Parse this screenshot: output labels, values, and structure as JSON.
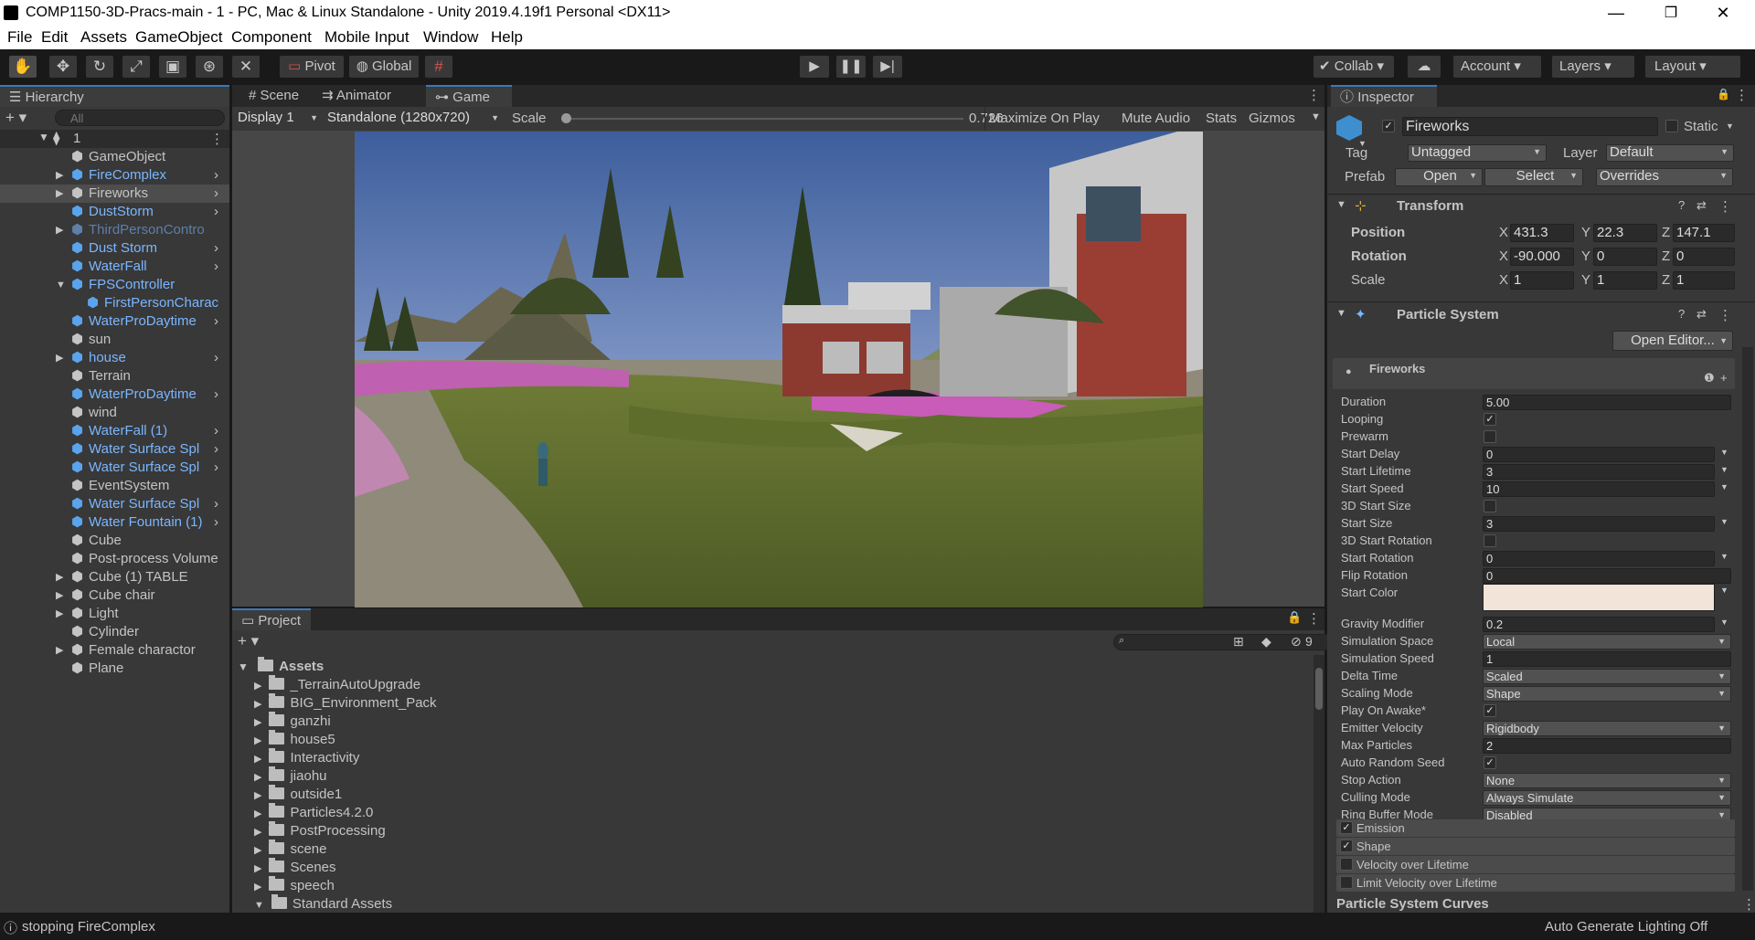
{
  "window": {
    "title": "COMP1150-3D-Pracs-main - 1 - PC, Mac & Linux Standalone - Unity 2019.4.19f1 Personal <DX11>",
    "minimize": "—",
    "restore": "❐",
    "close": "✕"
  },
  "menu": [
    "File",
    "Edit",
    "Assets",
    "GameObject",
    "Component",
    "Mobile Input",
    "Window",
    "Help"
  ],
  "toolbar": {
    "pivot": "Pivot",
    "global": "Global",
    "collab": "Collab",
    "account": "Account",
    "layers": "Layers",
    "layout": "Layout"
  },
  "hierarchy": {
    "tab": "Hierarchy",
    "search_placeholder": "All",
    "scene": "1",
    "items": [
      {
        "label": "GameObject",
        "color": "normal",
        "arrow": false,
        "child": false
      },
      {
        "label": "FireComplex",
        "color": "blue",
        "arrow": true,
        "child": false
      },
      {
        "label": "Fireworks",
        "color": "normal",
        "arrow": true,
        "child": false,
        "selected": true
      },
      {
        "label": "DustStorm",
        "color": "blue",
        "arrow": false,
        "child": false
      },
      {
        "label": "ThirdPersonContro",
        "color": "dim",
        "arrow": true,
        "child": false
      },
      {
        "label": "Dust Storm",
        "color": "blue",
        "arrow": false,
        "child": false
      },
      {
        "label": "WaterFall",
        "color": "blue",
        "arrow": false,
        "child": false
      },
      {
        "label": "FPSController",
        "color": "blue",
        "arrow": true,
        "child": false,
        "expanded": true
      },
      {
        "label": "FirstPersonCharac",
        "color": "blue",
        "arrow": false,
        "child": true
      },
      {
        "label": "WaterProDaytime",
        "color": "blue",
        "arrow": false,
        "child": false
      },
      {
        "label": "sun",
        "color": "normal",
        "arrow": false,
        "child": false
      },
      {
        "label": "house",
        "color": "blue",
        "arrow": true,
        "child": false
      },
      {
        "label": "Terrain",
        "color": "normal",
        "arrow": false,
        "child": false
      },
      {
        "label": "WaterProDaytime",
        "color": "blue",
        "arrow": false,
        "child": false
      },
      {
        "label": "wind",
        "color": "normal",
        "arrow": false,
        "child": false
      },
      {
        "label": "WaterFall (1)",
        "color": "blue",
        "arrow": false,
        "child": false
      },
      {
        "label": "Water Surface Spl",
        "color": "blue",
        "arrow": false,
        "child": false
      },
      {
        "label": "Water Surface Spl",
        "color": "blue",
        "arrow": false,
        "child": false
      },
      {
        "label": "EventSystem",
        "color": "normal",
        "arrow": false,
        "child": false
      },
      {
        "label": "Water Surface Spl",
        "color": "blue",
        "arrow": false,
        "child": false
      },
      {
        "label": "Water Fountain (1)",
        "color": "blue",
        "arrow": false,
        "child": false
      },
      {
        "label": "Cube",
        "color": "normal",
        "arrow": false,
        "child": false
      },
      {
        "label": "Post-process Volume",
        "color": "normal",
        "arrow": false,
        "child": false
      },
      {
        "label": "Cube (1) TABLE",
        "color": "normal",
        "arrow": true,
        "child": false
      },
      {
        "label": "Cube chair",
        "color": "normal",
        "arrow": true,
        "child": false
      },
      {
        "label": "Light",
        "color": "normal",
        "arrow": true,
        "child": false
      },
      {
        "label": "Cylinder",
        "color": "normal",
        "arrow": false,
        "child": false
      },
      {
        "label": "Female charactor",
        "color": "normal",
        "arrow": true,
        "child": false
      },
      {
        "label": "Plane",
        "color": "normal",
        "arrow": false,
        "child": false
      }
    ],
    "prefab_arrows": [
      1,
      2,
      3,
      5,
      6,
      9,
      11,
      13,
      15,
      16,
      17,
      19,
      20
    ]
  },
  "center_tabs": [
    "Scene",
    "Animator",
    "Game"
  ],
  "game": {
    "display": "Display 1",
    "resolution": "Standalone (1280x720)",
    "scale_label": "Scale",
    "scale_value": "0.726",
    "scale_fraction": 0.0,
    "maximize": "Maximize On Play",
    "mute": "Mute Audio",
    "stats": "Stats",
    "gizmos": "Gizmos"
  },
  "project": {
    "tab": "Project",
    "hidden_count": "9",
    "root": "Assets",
    "folders": [
      "_TerrainAutoUpgrade",
      "BIG_Environment_Pack",
      "ganzhi",
      "house5",
      "Interactivity",
      "jiaohu",
      "outside1",
      "Particles4.2.0",
      "PostProcessing",
      "scene",
      "Scenes",
      "speech",
      "Standard Assets"
    ]
  },
  "inspector": {
    "tab": "Inspector",
    "object_name": "Fireworks",
    "static_label": "Static",
    "tag_label": "Tag",
    "tag_value": "Untagged",
    "layer_label": "Layer",
    "layer_value": "Default",
    "prefab_label": "Prefab",
    "open": "Open",
    "select": "Select",
    "overrides": "Overrides",
    "transform": {
      "title": "Transform",
      "position_label": "Position",
      "rotation_label": "Rotation",
      "scale_label": "Scale",
      "position": {
        "x": "431.3",
        "y": "22.3",
        "z": "147.1"
      },
      "rotation": {
        "x": "-90.000",
        "y": "0",
        "z": "0"
      },
      "scale": {
        "x": "1",
        "y": "1",
        "z": "1"
      }
    },
    "particle": {
      "title": "Particle System",
      "open_editor": "Open Editor...",
      "module_name": "Fireworks",
      "rows": [
        {
          "label": "Duration",
          "kind": "text",
          "value": "5.00"
        },
        {
          "label": "Looping",
          "kind": "check",
          "value": "✓"
        },
        {
          "label": "Prewarm",
          "kind": "check",
          "value": ""
        },
        {
          "label": "Start Delay",
          "kind": "textdrop",
          "value": "0"
        },
        {
          "label": "Start Lifetime",
          "kind": "textdrop",
          "value": "3"
        },
        {
          "label": "Start Speed",
          "kind": "textdrop",
          "value": "10"
        },
        {
          "label": "3D Start Size",
          "kind": "check",
          "value": ""
        },
        {
          "label": "Start Size",
          "kind": "textdrop",
          "value": "3"
        },
        {
          "label": "3D Start Rotation",
          "kind": "check",
          "value": ""
        },
        {
          "label": "Start Rotation",
          "kind": "textdrop",
          "value": "0"
        },
        {
          "label": "Flip Rotation",
          "kind": "text",
          "value": "0"
        },
        {
          "label": "Start Color",
          "kind": "color",
          "value": ""
        },
        {
          "label": "Gravity Modifier",
          "kind": "textdrop",
          "value": "0.2"
        },
        {
          "label": "Simulation Space",
          "kind": "drop",
          "value": "Local"
        },
        {
          "label": "Simulation Speed",
          "kind": "text",
          "value": "1"
        },
        {
          "label": "Delta Time",
          "kind": "drop",
          "value": "Scaled"
        },
        {
          "label": "Scaling Mode",
          "kind": "drop",
          "value": "Shape"
        },
        {
          "label": "Play On Awake*",
          "kind": "check",
          "value": "✓"
        },
        {
          "label": "Emitter Velocity",
          "kind": "drop",
          "value": "Rigidbody"
        },
        {
          "label": "Max Particles",
          "kind": "text",
          "value": "2"
        },
        {
          "label": "Auto Random Seed",
          "kind": "check",
          "value": "✓"
        },
        {
          "label": "Stop Action",
          "kind": "drop",
          "value": "None"
        },
        {
          "label": "Culling Mode",
          "kind": "drop",
          "value": "Always Simulate"
        },
        {
          "label": "Ring Buffer Mode",
          "kind": "drop",
          "value": "Disabled"
        }
      ],
      "start_color": "#f2e4d8",
      "modules": [
        {
          "label": "Emission",
          "checked": "✓"
        },
        {
          "label": "Shape",
          "checked": "✓"
        },
        {
          "label": "Velocity over Lifetime",
          "checked": ""
        },
        {
          "label": "Limit Velocity over Lifetime",
          "checked": ""
        }
      ],
      "curves": "Particle System Curves"
    }
  },
  "status": {
    "message": "stopping FireComplex",
    "right": "Auto Generate Lighting Off"
  },
  "colors": {
    "accent": "#3a79bb",
    "panel": "#383838",
    "prefab_blue": "#7ab6ff"
  }
}
